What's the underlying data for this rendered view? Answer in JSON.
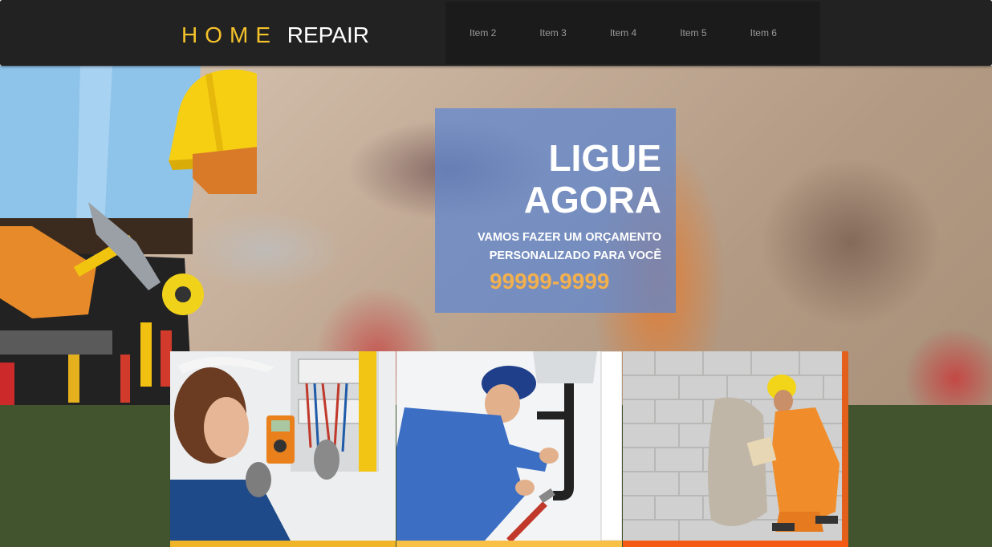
{
  "header": {
    "logo_home": "HOME",
    "logo_repair": "REPAIR",
    "nav": [
      "Item 2",
      "Item 3",
      "Item 4",
      "Item 5",
      "Item 6"
    ]
  },
  "hero": {
    "title_line1": "LIGUE",
    "title_line2": "AGORA",
    "subtitle_line1": "VAMOS FAZER UM ORÇAMENTO",
    "subtitle_line2": "PERSONALIZADO PARA VOCÊ",
    "phone": "99999-9999"
  },
  "colors": {
    "header_bg": "#222222",
    "logo_accent": "#f5c22b",
    "cta_box": "#5c87d2",
    "phone": "#f3b04e",
    "band": "#41542e",
    "card_bar_1": "#f0b428",
    "card_bar_2": "#f8c045",
    "card_bar_3": "#f55a14"
  },
  "cards": [
    {
      "image": "electrician-photo"
    },
    {
      "image": "plumber-photo"
    },
    {
      "image": "mason-photo"
    }
  ]
}
